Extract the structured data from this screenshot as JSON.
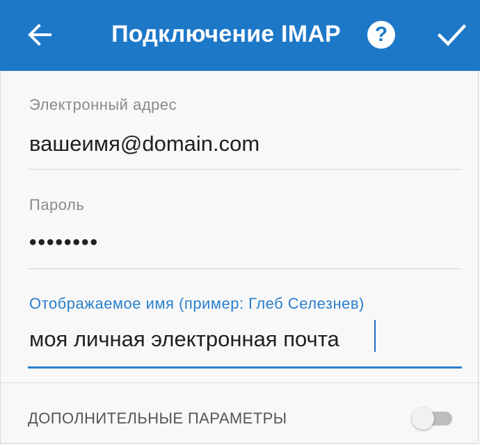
{
  "header": {
    "title": "Подключение IMAP",
    "help_symbol": "?",
    "back_icon": "arrow-left-icon",
    "confirm_icon": "checkmark-icon",
    "accent_color": "#1e78c8"
  },
  "form": {
    "email": {
      "label": "Электронный адрес",
      "value": "вашеимя@domain.com"
    },
    "password": {
      "label": "Пароль",
      "masked_value": "••••••••"
    },
    "display_name": {
      "label": "Отображаемое имя (пример: Глеб Селезнев)",
      "value": "моя личная электронная почта",
      "focused": true
    }
  },
  "advanced": {
    "label": "ДОПОЛНИТЕЛЬНЫЕ ПАРАМЕТРЫ",
    "toggle_on": false
  }
}
